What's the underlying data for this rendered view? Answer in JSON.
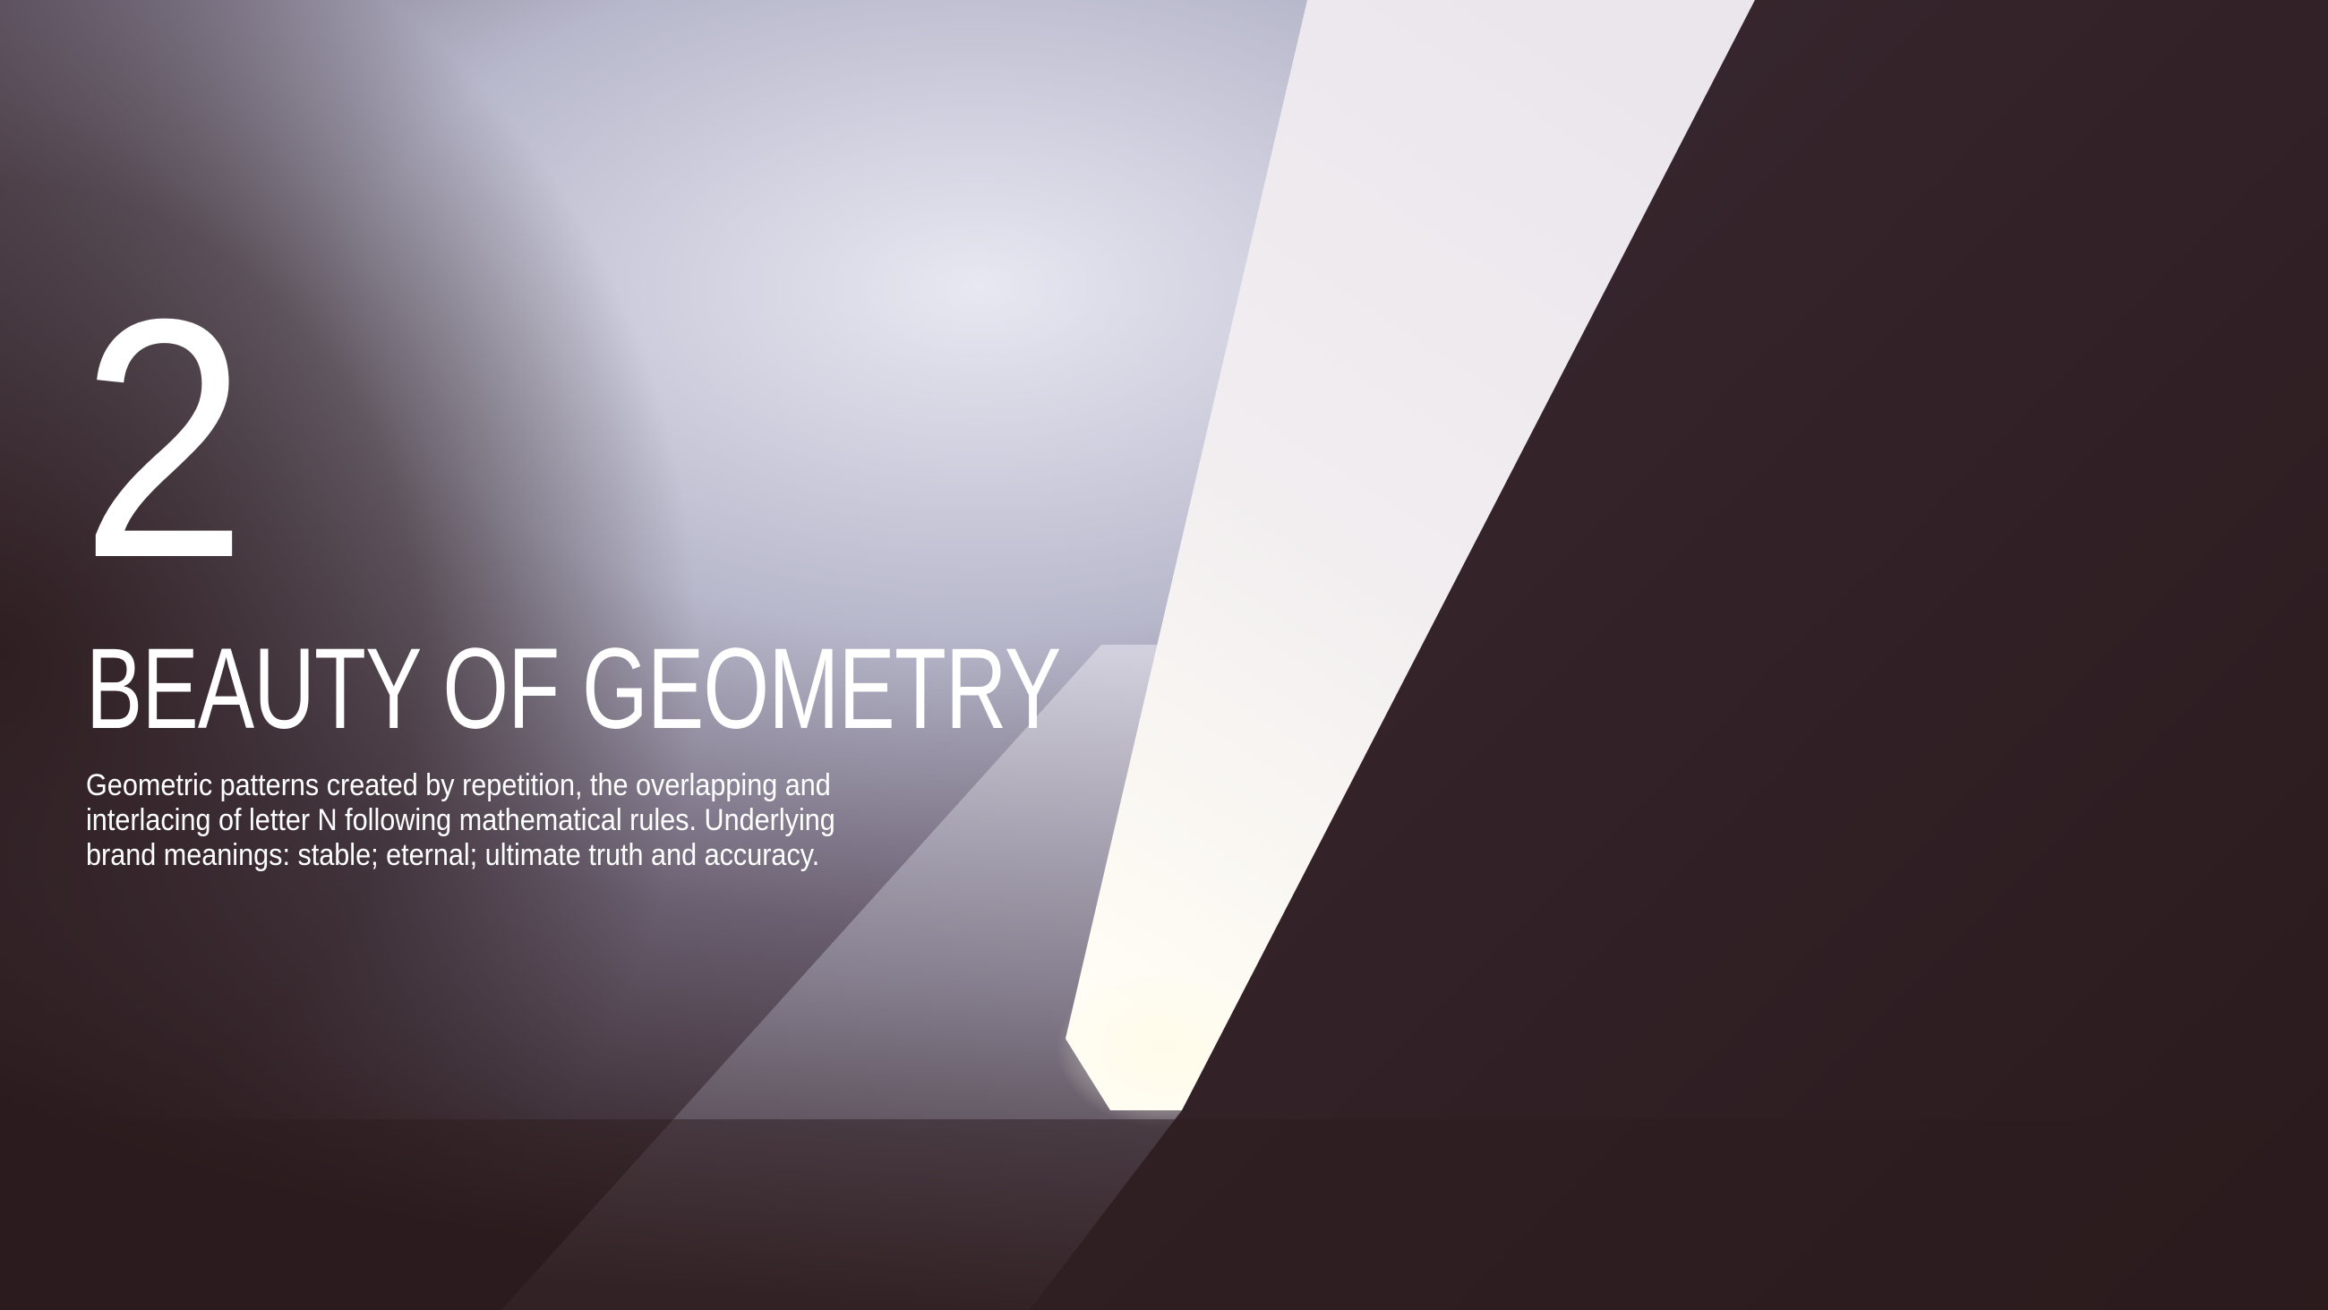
{
  "slide": {
    "number": "2",
    "title": "BEAUTY OF GEOMETRY",
    "description": "Geometric patterns created by repetition, the overlapping and interlacing of letter N following mathematical rules. Underlying brand meanings: stable; eternal; ultimate truth and accuracy."
  },
  "colors": {
    "background": "#2b1b1e",
    "light_beam": "#f4eeee",
    "text": "#ffffff"
  }
}
